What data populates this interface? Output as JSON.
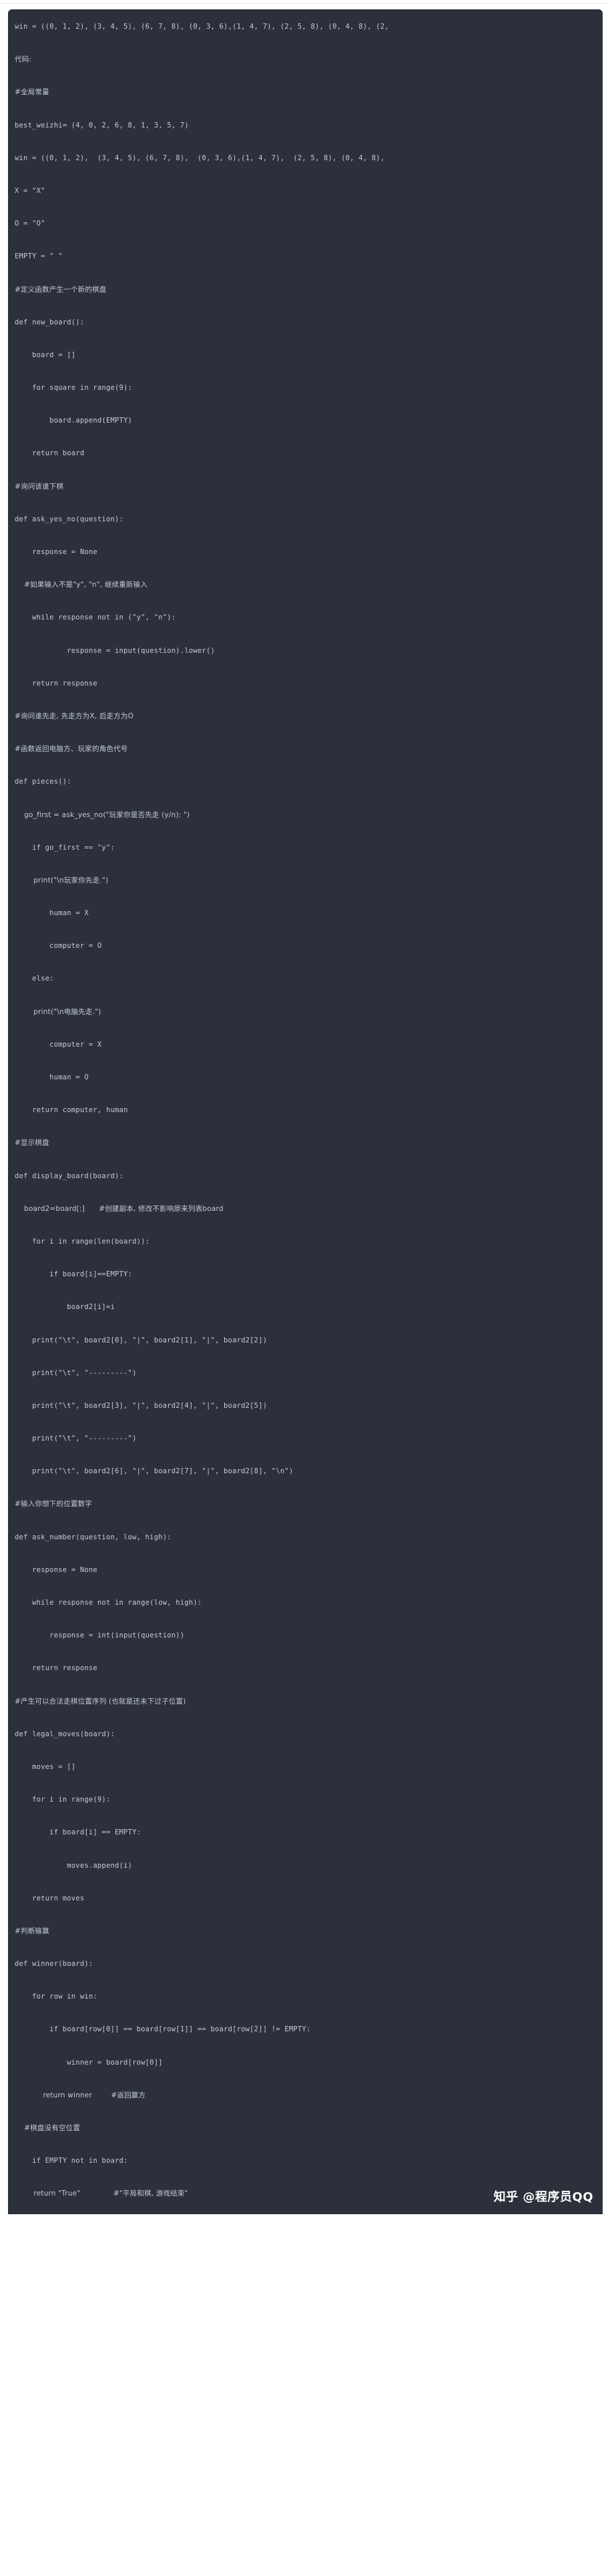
{
  "theme": {
    "code_background": "#2b303b",
    "code_text": "#c5cbd6",
    "page_background": "#ffffff",
    "watermark_color": "#ffffff"
  },
  "watermark": {
    "text": "知乎 @程序员QQ"
  },
  "code_block": {
    "language": "python",
    "lines": [
      "win = ((0, 1, 2), (3, 4, 5), (6, 7, 8), (0, 3, 6),(1, 4, 7), (2, 5, 8), (0, 4, 8), (2,",
      "",
      "代码:",
      "",
      "#全局常量",
      "",
      "best_weizhi= (4, 0, 2, 6, 8, 1, 3, 5, 7)",
      "",
      "win = ((0, 1, 2),  (3, 4, 5), (6, 7, 8),  (0, 3, 6),(1, 4, 7),  (2, 5, 8), (0, 4, 8),",
      "",
      "X = \"X\"",
      "",
      "O = \"O\"",
      "",
      "EMPTY = \" \"",
      "",
      "#定义函数产生一个新的棋盘",
      "",
      "def new_board():",
      "",
      "    board = []",
      "",
      "    for square in range(9):",
      "",
      "        board.append(EMPTY)",
      "",
      "    return board",
      "",
      "#询问该谁下棋",
      "",
      "def ask_yes_no(question):",
      "",
      "    response = None",
      "",
      "    #如果输入不是\"y\", \"n\", 继续重新输入",
      "",
      "    while response not in (\"y\", \"n\"):",
      "",
      "            response = input(question).lower()",
      "",
      "    return response",
      "",
      "#询问谁先走, 先走方为X, 后走方为O",
      "",
      "#函数返回电脑方、玩家的角色代号",
      "",
      "def pieces():",
      "",
      "    go_first = ask_yes_no(\"玩家你是否先走 (y/n): \")",
      "",
      "    if go_first == \"y\":",
      "",
      "        print(\"\\n玩家你先走.\")",
      "",
      "        human = X",
      "",
      "        computer = O",
      "",
      "    else:",
      "",
      "        print(\"\\n电脑先走.\")",
      "",
      "        computer = X",
      "",
      "        human = O",
      "",
      "    return computer, human",
      "",
      "#显示棋盘",
      "",
      "def display_board(board):",
      "",
      "    board2=board[:]      #创建副本, 修改不影响原来列表board",
      "",
      "    for i in range(len(board)):",
      "",
      "        if board[i]==EMPTY:",
      "",
      "            board2[i]=i",
      "",
      "    print(\"\\t\", board2[0], \"|\", board2[1], \"|\", board2[2])",
      "",
      "    print(\"\\t\", \"---------\")",
      "",
      "    print(\"\\t\", board2[3], \"|\", board2[4], \"|\", board2[5])",
      "",
      "    print(\"\\t\", \"---------\")",
      "",
      "    print(\"\\t\", board2[6], \"|\", board2[7], \"|\", board2[8], \"\\n\")",
      "",
      "#输入你想下的位置数字",
      "",
      "def ask_number(question, low, high):",
      "",
      "    response = None",
      "",
      "    while response not in range(low, high):",
      "",
      "        response = int(input(question))",
      "",
      "    return response",
      "",
      "#产生可以合法走棋位置序列 (也就是还未下过子位置)",
      "",
      "def legal_moves(board):",
      "",
      "    moves = []",
      "",
      "    for i in range(9):",
      "",
      "        if board[i] == EMPTY:",
      "",
      "            moves.append(i)",
      "",
      "    return moves",
      "",
      "#判断输赢",
      "",
      "def winner(board):",
      "",
      "    for row in win:",
      "",
      "        if board[row[0]] == board[row[1]] == board[row[2]] != EMPTY:",
      "",
      "            winner = board[row[0]]",
      "",
      "            return winner        #返回赢方",
      "",
      "    #棋盘没有空位置",
      "",
      "    if EMPTY not in board:",
      "",
      "        return \"True\"              #\"平局和棋, 游戏结束\""
    ]
  }
}
